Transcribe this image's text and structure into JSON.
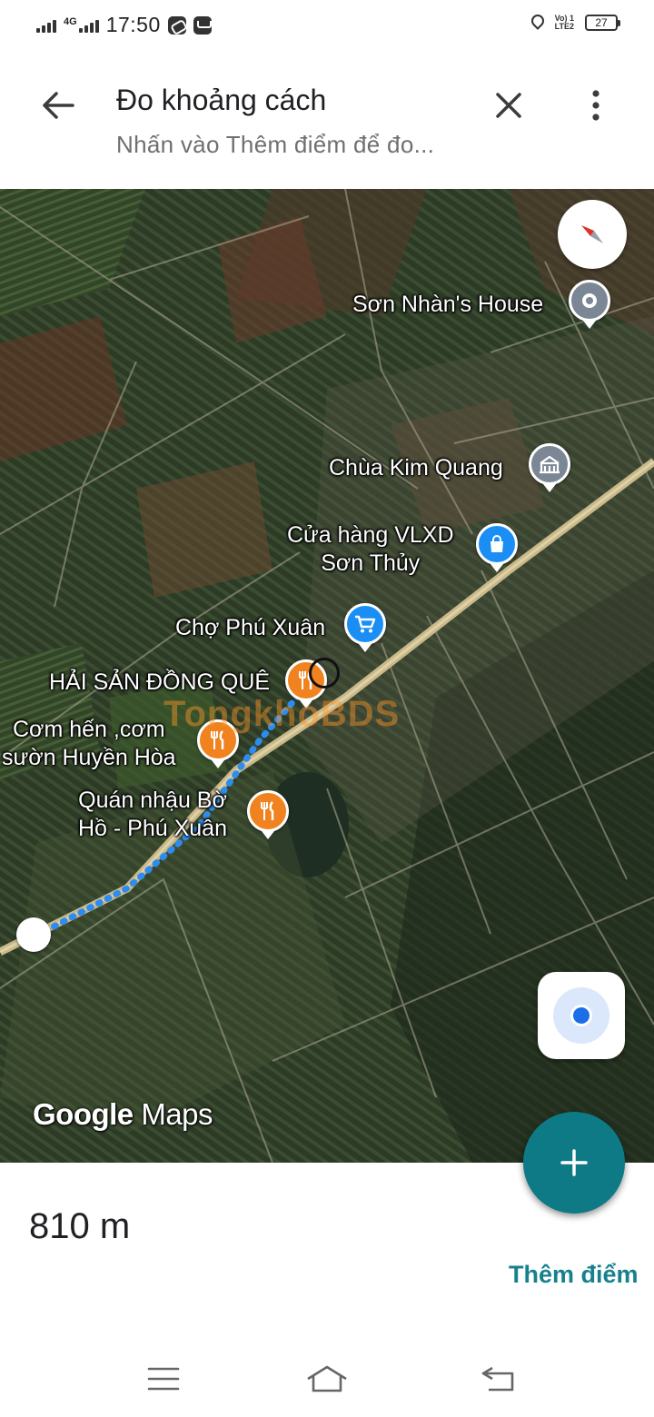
{
  "status_bar": {
    "network": "4G",
    "time": "17:50",
    "lte": "Vo) 1\nLTE2",
    "battery": "27"
  },
  "header": {
    "title": "Đo khoảng cách",
    "subtitle": "Nhấn vào Thêm điểm để đo..."
  },
  "map": {
    "places": [
      {
        "name": "Sơn Nhàn's House",
        "category": "home"
      },
      {
        "name": "Chùa Kim Quang",
        "category": "temple"
      },
      {
        "name": "Cửa hàng VLXD\nSơn Thủy",
        "category": "shopping"
      },
      {
        "name": "Chợ Phú Xuân",
        "category": "market"
      },
      {
        "name": "HẢI SẢN ĐỒNG QUÊ",
        "category": "restaurant"
      },
      {
        "name": "Cơm hến ,cơm\nsườn Huyền Hòa",
        "category": "restaurant"
      },
      {
        "name": "Quán nhậu Bờ\nHồ - Phú Xuân",
        "category": "restaurant"
      }
    ],
    "logo_left": "Google",
    "logo_right": "Maps",
    "watermark": "TongkhoBDS",
    "colors": {
      "restaurant_pin": "#f0821f",
      "shop_pin": "#1a8ef5",
      "accent": "#0d7a86",
      "measure_line": "#2e8cf0"
    }
  },
  "measurement": {
    "distance": "810 m",
    "add_point_label": "Thêm điểm"
  }
}
